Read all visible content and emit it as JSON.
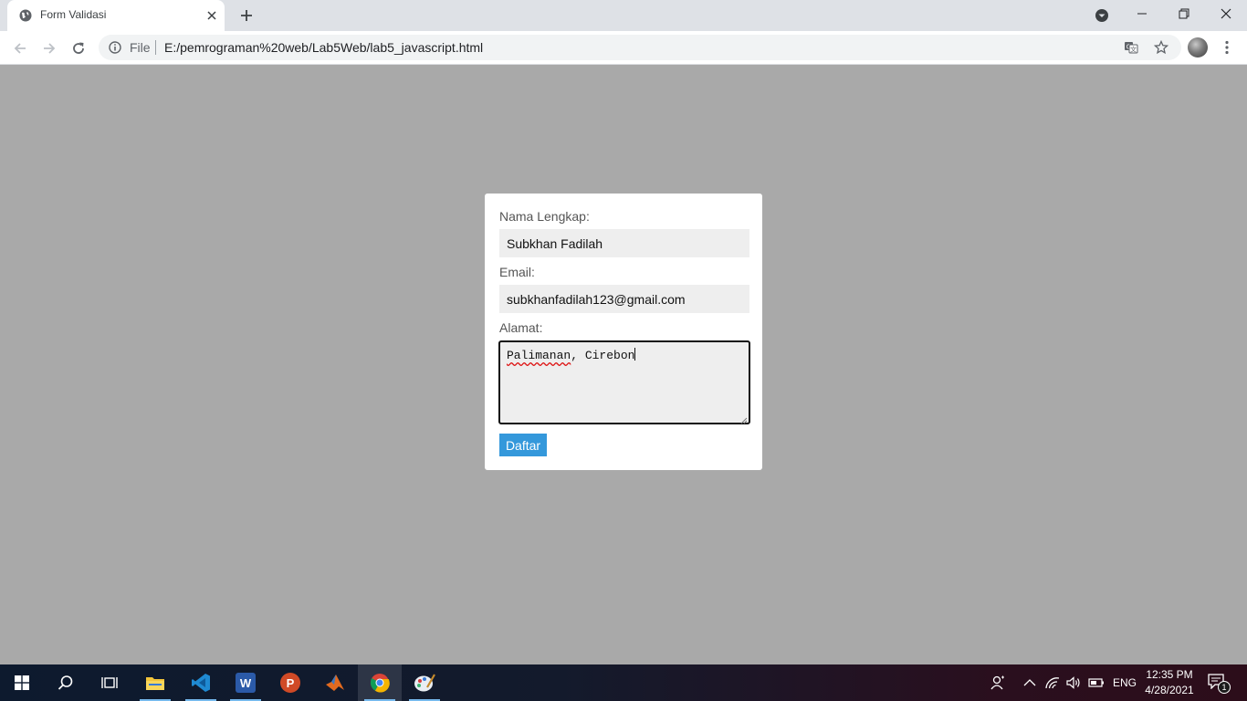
{
  "browser": {
    "tab": {
      "title": "Form Validasi"
    },
    "address_bar": {
      "scheme_label": "File",
      "url": "E:/pemrograman%20web/Lab5Web/lab5_javascript.html"
    }
  },
  "form": {
    "name_label": "Nama Lengkap:",
    "name_value": "Subkhan Fadilah",
    "email_label": "Email:",
    "email_value": "subkhanfadilah123@gmail.com",
    "address_label": "Alamat:",
    "address_value_word1": "Palimanan",
    "address_value_rest": ", Cirebon",
    "submit_label": "Daftar"
  },
  "taskbar": {
    "apps": [
      "start-icon",
      "search-icon",
      "task-view-icon",
      "file-explorer-icon",
      "vscode-icon",
      "word-icon",
      "powerpoint-icon",
      "matlab-icon",
      "chrome-icon",
      "paint-icon"
    ],
    "word_letter": "W",
    "powerpoint_letter": "P",
    "language": "ENG",
    "time": "12:35 PM",
    "date": "4/28/2021",
    "notification_count": "1"
  },
  "colors": {
    "page_background": "#a9a9a9",
    "submit_button": "#3498db",
    "input_background": "#eeeeee"
  }
}
